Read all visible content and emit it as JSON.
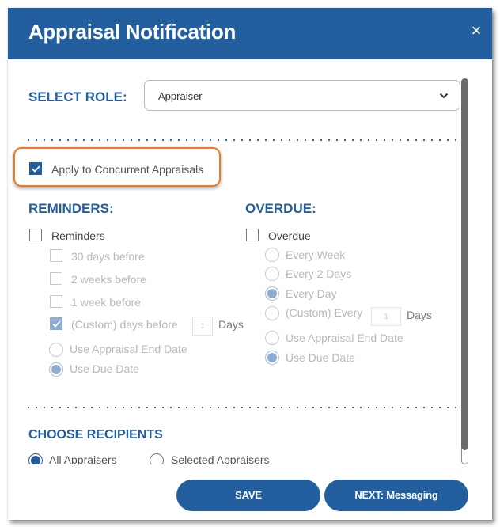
{
  "dialog": {
    "title": "Appraisal Notification",
    "close_icon": "×"
  },
  "role": {
    "label": "SELECT ROLE:",
    "selected": "Appraiser"
  },
  "concurrent": {
    "label": "Apply to Concurrent Appraisals",
    "checked": true
  },
  "reminders": {
    "heading": "REMINDERS:",
    "main_label": "Reminders",
    "main_checked": false,
    "options": [
      {
        "label": "30 days before",
        "checked": false
      },
      {
        "label": "2 weeks before",
        "checked": false
      },
      {
        "label": "1 week before",
        "checked": false
      },
      {
        "label": "(Custom) days before",
        "checked": true
      }
    ],
    "custom_days_value": "1",
    "days_label": "Days",
    "date_options": [
      {
        "label": "Use Appraisal End Date",
        "selected": false
      },
      {
        "label": "Use Due Date",
        "selected": true
      }
    ]
  },
  "overdue": {
    "heading": "OVERDUE:",
    "main_label": "Overdue",
    "main_checked": false,
    "frequency_options": [
      {
        "label": "Every Week",
        "selected": false
      },
      {
        "label": "Every 2 Days",
        "selected": false
      },
      {
        "label": "Every Day",
        "selected": true
      },
      {
        "label": "(Custom) Every",
        "selected": false
      }
    ],
    "custom_days_value": "1",
    "days_label": "Days",
    "date_options": [
      {
        "label": "Use Appraisal End Date",
        "selected": false
      },
      {
        "label": "Use Due Date",
        "selected": true
      }
    ]
  },
  "recipients": {
    "heading": "CHOOSE RECIPIENTS",
    "options": [
      {
        "label": "All Appraisers",
        "selected": true
      },
      {
        "label": "Selected Appraisers",
        "selected": false
      }
    ]
  },
  "footer": {
    "save_label": "SAVE",
    "next_label": "NEXT: Messaging"
  },
  "colors": {
    "brand": "#235f9e",
    "highlight": "#f07a1c",
    "disabled_fill": "#8fadd2"
  }
}
